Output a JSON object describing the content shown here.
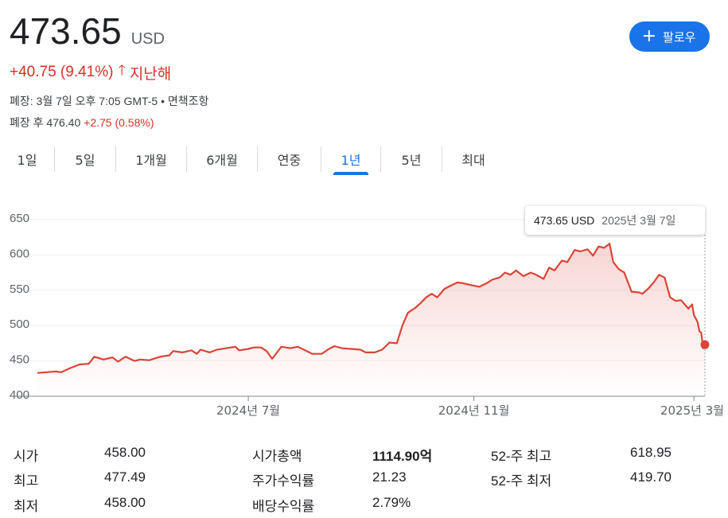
{
  "quote": {
    "price": "473.65",
    "currency": "USD",
    "change": "+40.75 (9.41%)",
    "period": "지난해",
    "closed_info": "폐장: 3월 7일 오후 7:05 GMT-5 • 면책조항",
    "after_label": "폐장 후 476.40",
    "after_change": "+2.75 (0.58%)"
  },
  "follow_button": {
    "label": "팔로우"
  },
  "tabs": [
    "1일",
    "5일",
    "1개월",
    "6개월",
    "연중",
    "1년",
    "5년",
    "최대"
  ],
  "active_tab": "1년",
  "tooltip": {
    "price": "473.65 USD",
    "date": "2025년 3월 7일"
  },
  "colors": {
    "line": "#db4437",
    "accent": "#1a73e8",
    "negative": "#d93025"
  },
  "stats": {
    "col1": [
      {
        "label": "시가",
        "value": "458.00"
      },
      {
        "label": "최고",
        "value": "477.49"
      },
      {
        "label": "최저",
        "value": "458.00"
      }
    ],
    "col2": [
      {
        "label": "시가총액",
        "value": "1114.90억"
      },
      {
        "label": "주가수익률",
        "value": "21.23"
      },
      {
        "label": "배당수익률",
        "value": "2.79%"
      }
    ],
    "col3": [
      {
        "label": "52-주 최고",
        "value": "618.95"
      },
      {
        "label": "52-주 최저",
        "value": "419.70"
      }
    ]
  },
  "chart_data": {
    "type": "area",
    "title": "",
    "xlabel": "",
    "ylabel": "",
    "ylim": [
      400,
      650
    ],
    "yticks": [
      400,
      450,
      500,
      550,
      600,
      650
    ],
    "xticks": [
      {
        "label": "2024년 7월",
        "date": "2024-07-01"
      },
      {
        "label": "2024년 11월",
        "date": "2024-11-01"
      },
      {
        "label": "2025년 3월",
        "date": "2025-03-01"
      }
    ],
    "x_range": [
      "2024-03-08",
      "2025-03-07"
    ],
    "grid": true,
    "series": [
      {
        "name": "",
        "points": [
          [
            "2024-03-08",
            433
          ],
          [
            "2024-03-13",
            434
          ],
          [
            "2024-03-18",
            435
          ],
          [
            "2024-03-21",
            434
          ],
          [
            "2024-03-26",
            440
          ],
          [
            "2024-03-31",
            445
          ],
          [
            "2024-04-05",
            446
          ],
          [
            "2024-04-08",
            456
          ],
          [
            "2024-04-13",
            452
          ],
          [
            "2024-04-18",
            455
          ],
          [
            "2024-04-21",
            449
          ],
          [
            "2024-04-25",
            456
          ],
          [
            "2024-04-30",
            450
          ],
          [
            "2024-05-03",
            452
          ],
          [
            "2024-05-08",
            451
          ],
          [
            "2024-05-14",
            456
          ],
          [
            "2024-05-19",
            458
          ],
          [
            "2024-05-21",
            464
          ],
          [
            "2024-05-26",
            462
          ],
          [
            "2024-05-31",
            465
          ],
          [
            "2024-06-03",
            460
          ],
          [
            "2024-06-05",
            466
          ],
          [
            "2024-06-10",
            462
          ],
          [
            "2024-06-14",
            466
          ],
          [
            "2024-06-19",
            468
          ],
          [
            "2024-06-24",
            470
          ],
          [
            "2024-06-26",
            465
          ],
          [
            "2024-07-01",
            467
          ],
          [
            "2024-07-04",
            469
          ],
          [
            "2024-07-08",
            469
          ],
          [
            "2024-07-11",
            464
          ],
          [
            "2024-07-14",
            453
          ],
          [
            "2024-07-19",
            470
          ],
          [
            "2024-07-24",
            468
          ],
          [
            "2024-07-28",
            470
          ],
          [
            "2024-08-01",
            465
          ],
          [
            "2024-08-05",
            460
          ],
          [
            "2024-08-10",
            460
          ],
          [
            "2024-08-14",
            467
          ],
          [
            "2024-08-17",
            471
          ],
          [
            "2024-08-21",
            468
          ],
          [
            "2024-08-26",
            467
          ],
          [
            "2024-08-31",
            466
          ],
          [
            "2024-09-03",
            462
          ],
          [
            "2024-09-08",
            462
          ],
          [
            "2024-09-12",
            466
          ],
          [
            "2024-09-16",
            476
          ],
          [
            "2024-09-20",
            475
          ],
          [
            "2024-09-23",
            500
          ],
          [
            "2024-09-26",
            518
          ],
          [
            "2024-09-30",
            525
          ],
          [
            "2024-10-03",
            532
          ],
          [
            "2024-10-06",
            540
          ],
          [
            "2024-10-09",
            545
          ],
          [
            "2024-10-12",
            540
          ],
          [
            "2024-10-16",
            552
          ],
          [
            "2024-10-19",
            556
          ],
          [
            "2024-10-23",
            561
          ],
          [
            "2024-10-26",
            560
          ],
          [
            "2024-10-31",
            557
          ],
          [
            "2024-11-04",
            555
          ],
          [
            "2024-11-08",
            560
          ],
          [
            "2024-11-11",
            565
          ],
          [
            "2024-11-15",
            568
          ],
          [
            "2024-11-18",
            575
          ],
          [
            "2024-11-21",
            572
          ],
          [
            "2024-11-24",
            578
          ],
          [
            "2024-11-28",
            570
          ],
          [
            "2024-12-02",
            575
          ],
          [
            "2024-12-05",
            572
          ],
          [
            "2024-12-09",
            566
          ],
          [
            "2024-12-12",
            582
          ],
          [
            "2024-12-15",
            578
          ],
          [
            "2024-12-19",
            592
          ],
          [
            "2024-12-22",
            590
          ],
          [
            "2024-12-26",
            607
          ],
          [
            "2024-12-29",
            605
          ],
          [
            "2025-01-02",
            608
          ],
          [
            "2025-01-05",
            599
          ],
          [
            "2025-01-08",
            612
          ],
          [
            "2025-01-11",
            610
          ],
          [
            "2025-01-14",
            616
          ],
          [
            "2025-01-16",
            590
          ],
          [
            "2025-01-19",
            580
          ],
          [
            "2025-01-22",
            575
          ],
          [
            "2025-01-26",
            548
          ],
          [
            "2025-01-30",
            547
          ],
          [
            "2025-02-01",
            545
          ],
          [
            "2025-02-04",
            552
          ],
          [
            "2025-02-07",
            561
          ],
          [
            "2025-02-10",
            572
          ],
          [
            "2025-02-13",
            568
          ],
          [
            "2025-02-16",
            540
          ],
          [
            "2025-02-19",
            535
          ],
          [
            "2025-02-22",
            536
          ],
          [
            "2025-02-24",
            530
          ],
          [
            "2025-02-26",
            524
          ],
          [
            "2025-02-28",
            530
          ],
          [
            "2025-03-01",
            515
          ],
          [
            "2025-03-03",
            505
          ],
          [
            "2025-03-04",
            492
          ],
          [
            "2025-03-05",
            490
          ],
          [
            "2025-03-06",
            468
          ],
          [
            "2025-03-07",
            473
          ]
        ]
      }
    ]
  }
}
